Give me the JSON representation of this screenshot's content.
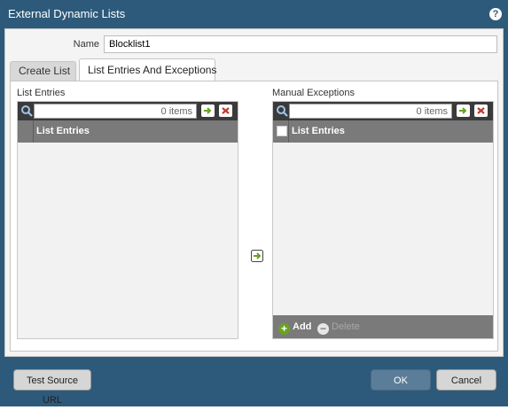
{
  "dialog": {
    "title": "External Dynamic Lists",
    "help_icon": "help-icon",
    "name_label": "Name",
    "name_value": "Blocklist1"
  },
  "tabs": [
    {
      "label": "Create List",
      "active": false
    },
    {
      "label": "List Entries And Exceptions",
      "active": true
    }
  ],
  "list_entries": {
    "section_title": "List Entries",
    "search_count": "0 items",
    "column_header": "List Entries"
  },
  "manual_exceptions": {
    "section_title": "Manual Exceptions",
    "search_count": "0 items",
    "column_header": "List Entries",
    "add_label": "Add",
    "delete_label": "Delete"
  },
  "buttons": {
    "test_source_url": "Test Source URL",
    "ok": "OK",
    "cancel": "Cancel"
  },
  "colors": {
    "titlebar": "#2d5a7a",
    "toolbar": "#3a3a3a",
    "header": "#7a7a7a",
    "go_arrow": "#6aa121",
    "clear": "#c0392b"
  }
}
